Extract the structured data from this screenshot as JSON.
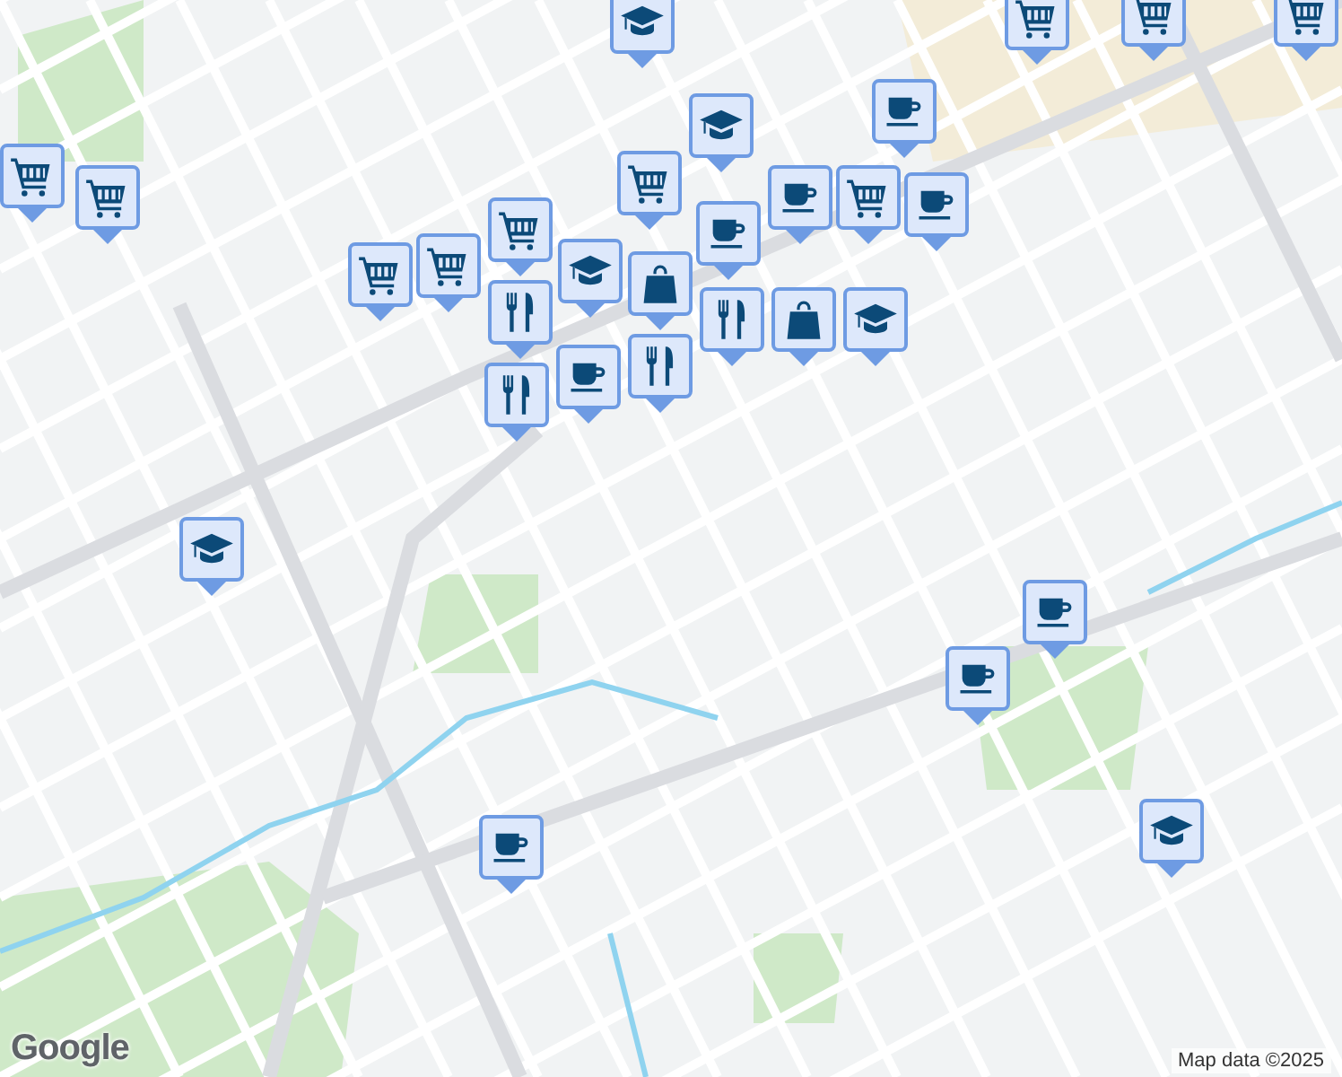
{
  "map": {
    "markers": [
      {
        "kind": "school"
      },
      {
        "kind": "cart"
      },
      {
        "kind": "cart"
      },
      {
        "kind": "cart"
      },
      {
        "kind": "cart"
      },
      {
        "kind": "cart"
      },
      {
        "kind": "cart"
      },
      {
        "kind": "cart"
      },
      {
        "kind": "cart"
      },
      {
        "kind": "cart"
      },
      {
        "kind": "school"
      },
      {
        "kind": "cafe"
      },
      {
        "kind": "cart"
      },
      {
        "kind": "cafe"
      },
      {
        "kind": "cafe"
      },
      {
        "kind": "cafe"
      },
      {
        "kind": "school"
      },
      {
        "kind": "restaurant"
      },
      {
        "kind": "restaurant"
      },
      {
        "kind": "bag"
      },
      {
        "kind": "restaurant"
      },
      {
        "kind": "restaurant"
      },
      {
        "kind": "bag"
      },
      {
        "kind": "school"
      },
      {
        "kind": "cafe"
      },
      {
        "kind": "school"
      },
      {
        "kind": "cafe"
      },
      {
        "kind": "cafe"
      },
      {
        "kind": "cafe"
      },
      {
        "kind": "school"
      }
    ]
  },
  "logo": "Google",
  "attribution": "Map data ©2025"
}
